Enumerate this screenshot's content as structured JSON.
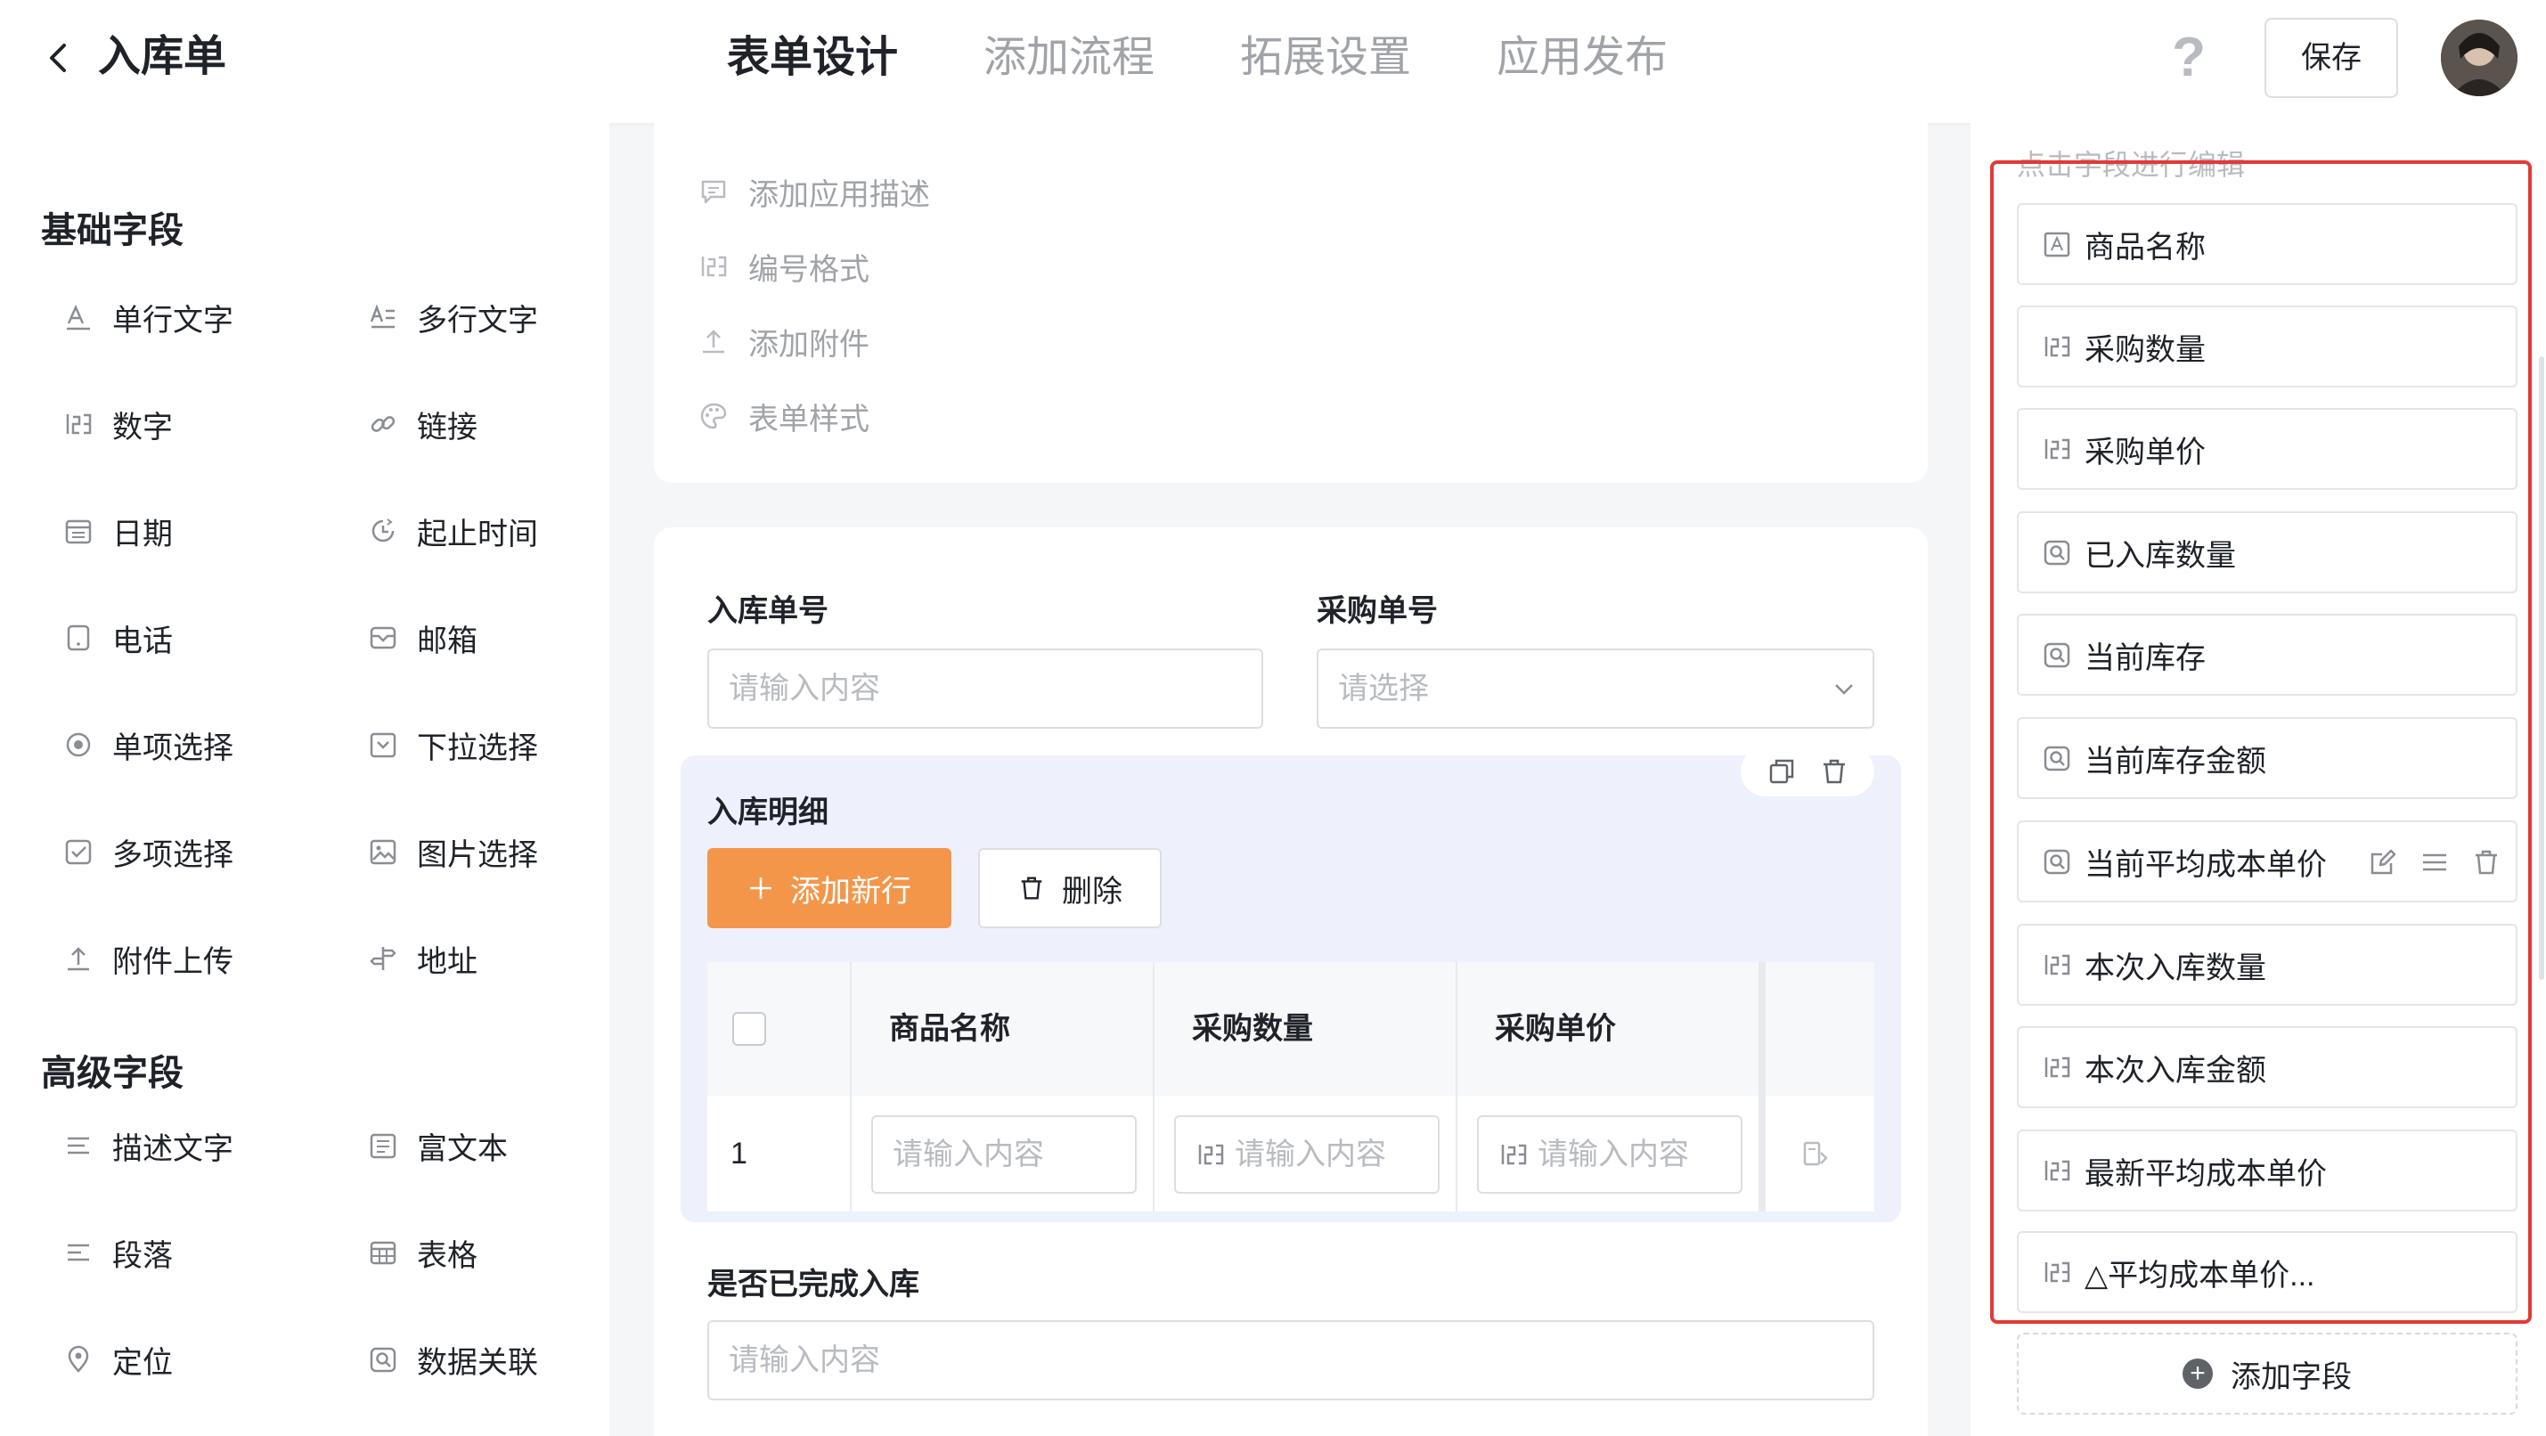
{
  "header": {
    "title": "入库单",
    "tabs": [
      {
        "label": "表单设计",
        "active": true
      },
      {
        "label": "添加流程",
        "active": false
      },
      {
        "label": "拓展设置",
        "active": false
      },
      {
        "label": "应用发布",
        "active": false
      }
    ],
    "help_label": "?",
    "save_label": "保存"
  },
  "left_panel": {
    "basic_title": "基础字段",
    "basic_fields": [
      {
        "label": "单行文字",
        "icon": "single-line-text-icon"
      },
      {
        "label": "多行文字",
        "icon": "multi-line-text-icon"
      },
      {
        "label": "数字",
        "icon": "number-icon"
      },
      {
        "label": "链接",
        "icon": "link-icon"
      },
      {
        "label": "日期",
        "icon": "calendar-icon"
      },
      {
        "label": "起止时间",
        "icon": "time-range-icon"
      },
      {
        "label": "电话",
        "icon": "phone-icon"
      },
      {
        "label": "邮箱",
        "icon": "mail-icon"
      },
      {
        "label": "单项选择",
        "icon": "radio-icon"
      },
      {
        "label": "下拉选择",
        "icon": "dropdown-icon"
      },
      {
        "label": "多项选择",
        "icon": "checkbox-icon"
      },
      {
        "label": "图片选择",
        "icon": "image-icon"
      },
      {
        "label": "附件上传",
        "icon": "upload-icon"
      },
      {
        "label": "地址",
        "icon": "signpost-icon"
      }
    ],
    "advanced_title": "高级字段",
    "advanced_fields": [
      {
        "label": "描述文字",
        "icon": "description-icon"
      },
      {
        "label": "富文本",
        "icon": "rich-text-icon"
      },
      {
        "label": "段落",
        "icon": "paragraph-icon"
      },
      {
        "label": "表格",
        "icon": "table-icon"
      },
      {
        "label": "定位",
        "icon": "location-icon"
      },
      {
        "label": "数据关联",
        "icon": "data-link-icon"
      }
    ]
  },
  "form_options": [
    {
      "label": "添加应用描述",
      "icon": "comment-icon"
    },
    {
      "label": "编号格式",
      "icon": "serial-number-icon"
    },
    {
      "label": "添加附件",
      "icon": "upload-icon"
    },
    {
      "label": "表单样式",
      "icon": "palette-icon"
    }
  ],
  "form": {
    "inbound_no_label": "入库单号",
    "inbound_no_placeholder": "请输入内容",
    "purchase_no_label": "采购单号",
    "purchase_no_placeholder": "请选择",
    "detail_title": "入库明细",
    "add_row_label": "添加新行",
    "delete_label": "删除",
    "table_headers": [
      "商品名称",
      "采购数量",
      "采购单价"
    ],
    "row_index": "1",
    "cell_placeholder": "请输入内容",
    "completed_label": "是否已完成入库",
    "completed_placeholder": "请输入内容"
  },
  "right_panel": {
    "hint": "点击字段进行编辑",
    "fields": [
      {
        "label": "商品名称",
        "icon": "text-field-icon"
      },
      {
        "label": "采购数量",
        "icon": "number-field-icon"
      },
      {
        "label": "采购单价",
        "icon": "number-field-icon"
      },
      {
        "label": "已入库数量",
        "icon": "lookup-field-icon"
      },
      {
        "label": "当前库存",
        "icon": "lookup-field-icon"
      },
      {
        "label": "当前库存金额",
        "icon": "lookup-field-icon"
      },
      {
        "label": "当前平均成本单价",
        "icon": "lookup-field-icon",
        "hovered": true
      },
      {
        "label": "本次入库数量",
        "icon": "number-field-icon"
      },
      {
        "label": "本次入库金额",
        "icon": "number-field-icon"
      },
      {
        "label": "最新平均成本单价",
        "icon": "number-field-icon"
      },
      {
        "label": "△平均成本单价...",
        "icon": "number-field-icon"
      }
    ],
    "add_field_label": "添加字段"
  },
  "colors": {
    "accent": "#f3964a",
    "highlight_border": "#e53935",
    "subform_bg": "#eef1fb"
  }
}
